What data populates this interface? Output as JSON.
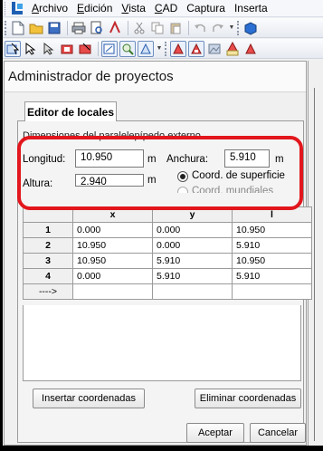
{
  "menubar": {
    "items": [
      {
        "label": "Archivo",
        "accel": "A",
        "rest": "rchivo"
      },
      {
        "label": "Edición",
        "accel": "E",
        "rest": "dición"
      },
      {
        "label": "Vista",
        "accel": "V",
        "rest": "ista"
      },
      {
        "label": "CAD",
        "accel": "C",
        "rest": "AD"
      },
      {
        "label": "Captura",
        "accel": "",
        "rest": "Captura"
      },
      {
        "label": "Inserta",
        "accel": "",
        "rest": "Inserta"
      }
    ]
  },
  "panel": {
    "title": "Administrador de proyectos",
    "tab_label": "Editor de locales",
    "group_title": "Dimensiones del paralelepípedo externo",
    "longitud": {
      "label": "Longitud:",
      "value": "10.950",
      "unit": "m"
    },
    "anchura": {
      "label": "Anchura:",
      "value": "5.910",
      "unit": "m"
    },
    "altura": {
      "label": "Altura:",
      "value": "2.940",
      "unit": "m"
    },
    "radio_surface": "Coord. de superficie",
    "radio_world": "Coord. mundiales",
    "grid": {
      "headers": [
        "x",
        "y",
        "l"
      ],
      "rows": [
        {
          "n": "1",
          "x": "0.000",
          "y": "0.000",
          "l": "10.950"
        },
        {
          "n": "2",
          "x": "10.950",
          "y": "0.000",
          "l": "5.910"
        },
        {
          "n": "3",
          "x": "10.950",
          "y": "5.910",
          "l": "10.950"
        },
        {
          "n": "4",
          "x": "0.000",
          "y": "5.910",
          "l": "5.910"
        }
      ],
      "new_row_marker": "---->"
    },
    "insert_button": "Insertar coordenadas",
    "delete_button": "Eliminar coordenadas",
    "accept_button": "Aceptar",
    "cancel_button": "Cancelar"
  },
  "colors": {
    "highlight": "#e2161c",
    "accent": "#1e5fb3"
  }
}
